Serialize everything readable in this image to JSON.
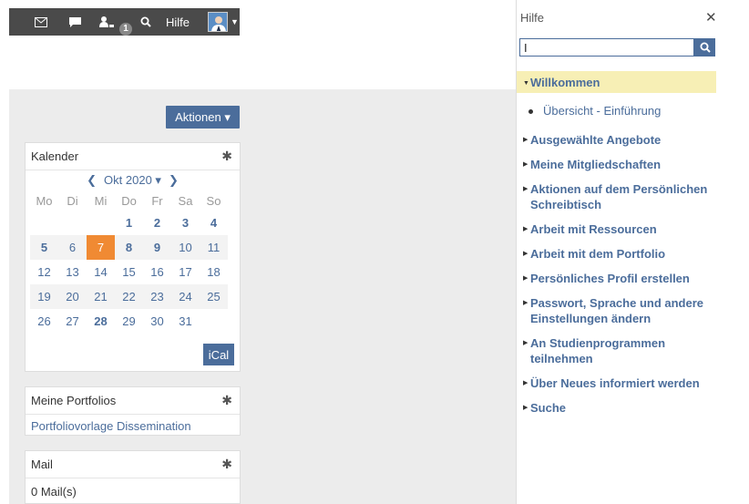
{
  "topbar": {
    "icons": [
      "mail-icon",
      "chat-icon",
      "users-icon",
      "search-icon"
    ],
    "badge": "1",
    "hilfe": "Hilfe"
  },
  "aktionen": "Aktionen ▾",
  "calendar": {
    "title": "Kalender",
    "month": "Okt 2020 ▾",
    "weekdays": [
      "Mo",
      "Di",
      "Mi",
      "Do",
      "Fr",
      "Sa",
      "So"
    ],
    "weeks": [
      [
        "",
        "",
        "",
        "1",
        "2",
        "3",
        "4"
      ],
      [
        "5",
        "6",
        "7",
        "8",
        "9",
        "10",
        "11"
      ],
      [
        "12",
        "13",
        "14",
        "15",
        "16",
        "17",
        "18"
      ],
      [
        "19",
        "20",
        "21",
        "22",
        "23",
        "24",
        "25"
      ],
      [
        "26",
        "27",
        "28",
        "29",
        "30",
        "31",
        ""
      ]
    ],
    "today": "7",
    "bold_days": [
      "1",
      "2",
      "3",
      "4",
      "5",
      "8",
      "9",
      "28"
    ],
    "ical": "iCal"
  },
  "portfolios": {
    "title": "Meine Portfolios",
    "item": "Portfoliovorlage Dissemination"
  },
  "mail": {
    "title": "Mail",
    "count": "0 Mail(s)"
  },
  "help": {
    "title": "Hilfe",
    "close": "✕",
    "search_value": "I",
    "active": "Willkommen",
    "sub": "Übersicht - Einführung",
    "items": [
      "Ausgewählte Angebote",
      "Meine Mitgliedschaften",
      "Aktionen auf dem Persönlichen Schreibtisch",
      "Arbeit mit Ressourcen",
      "Arbeit mit dem Portfolio",
      "Persönliches Profil erstellen",
      "Passwort, Sprache und andere Einstellungen ändern",
      "An Studienprogrammen teilnehmen",
      "Über Neues informiert werden",
      "Suche"
    ]
  },
  "colors": {
    "accent": "#4b6d9b",
    "today": "#f08a33",
    "highlight": "#f7efb5",
    "topbar": "#4a4a4a"
  }
}
